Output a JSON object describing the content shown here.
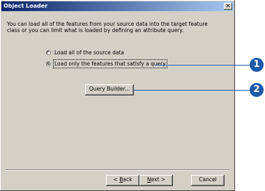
{
  "window": {
    "title": "Object Loader"
  },
  "description": "You can load all of the features from your source data into the target feature class or you can limit what is loaded by defining an attribute query.",
  "options": [
    {
      "label": "Load all of the source data",
      "selected": false
    },
    {
      "label": "Load only the features that satisfy a query",
      "selected": true
    }
  ],
  "query_builder_label": "Query Builder...",
  "footer": {
    "back": {
      "underline": "B",
      "rest": "ack",
      "prefix": "< "
    },
    "next": {
      "underline": "N",
      "rest": "ext >"
    },
    "cancel": "Cancel"
  },
  "callouts": [
    "1",
    "2"
  ],
  "colors": {
    "callout": "#1d5aa8",
    "titlebar_start": "#0a246a",
    "titlebar_end": "#a6caf0"
  }
}
